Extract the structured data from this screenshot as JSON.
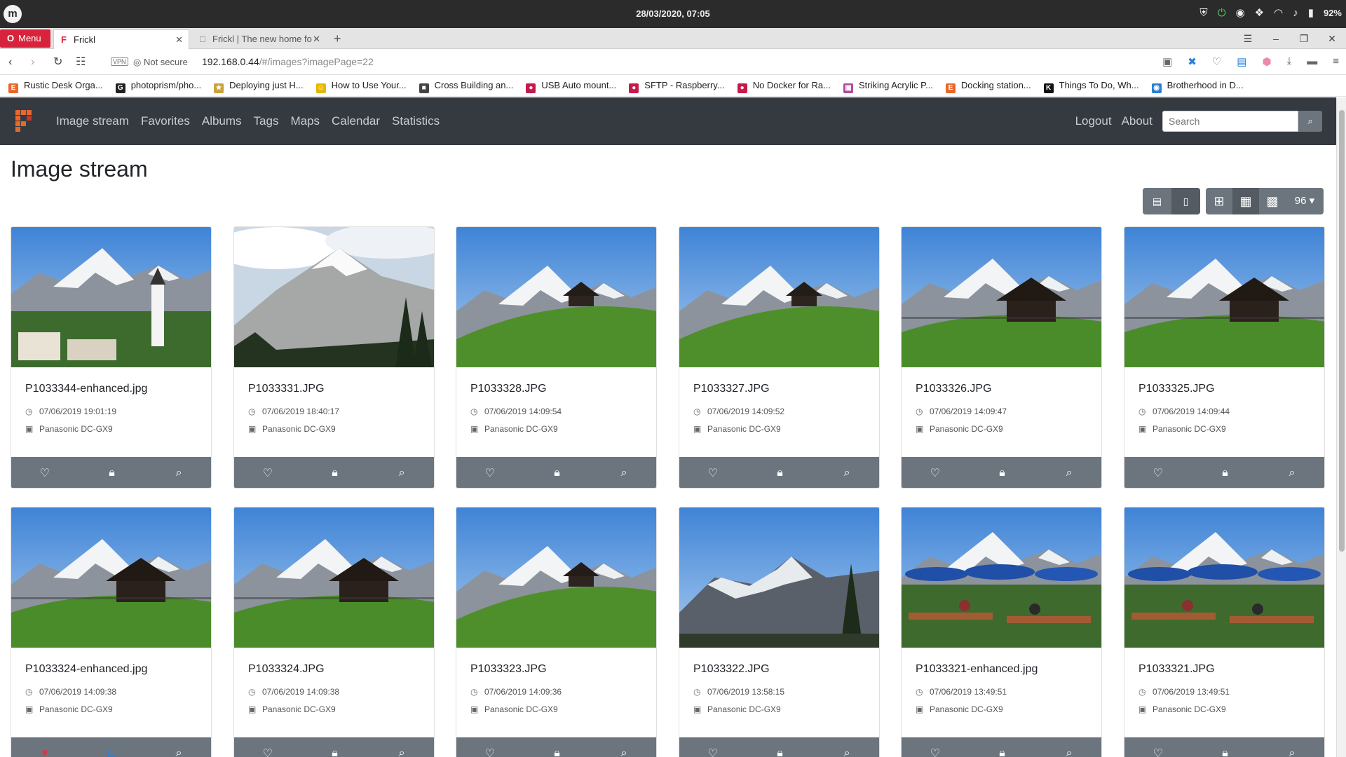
{
  "os": {
    "clock": "28/03/2020, 07:05",
    "battery": "92%"
  },
  "browser": {
    "menu_label": "Menu",
    "tabs": [
      {
        "title": "Frickl"
      },
      {
        "title": "Frickl | The new home fo"
      }
    ],
    "vpn": "VPN",
    "security": "Not secure",
    "url_host": "192.168.0.44",
    "url_rest": "/#/images?imagePage=22",
    "bookmarks": [
      {
        "label": "Rustic Desk Orga...",
        "color": "#e8672a",
        "letter": "E"
      },
      {
        "label": "photoprism/pho...",
        "color": "#222222",
        "letter": "G"
      },
      {
        "label": "Deploying just H...",
        "color": "#c9a23a",
        "letter": "★"
      },
      {
        "label": "How to Use Your...",
        "color": "#e6b800",
        "letter": "☺"
      },
      {
        "label": "Cross Building an...",
        "color": "#444444",
        "letter": "■"
      },
      {
        "label": "USB Auto mount...",
        "color": "#c51a4a",
        "letter": "●"
      },
      {
        "label": "SFTP - Raspberry...",
        "color": "#c51a4a",
        "letter": "●"
      },
      {
        "label": "No Docker for Ra...",
        "color": "#c51a4a",
        "letter": "●"
      },
      {
        "label": "Striking Acrylic P...",
        "color": "#b04a9e",
        "letter": "▣"
      },
      {
        "label": "Docking station...",
        "color": "#e8672a",
        "letter": "E"
      },
      {
        "label": "Things To Do, Wh...",
        "color": "#111111",
        "letter": "K"
      },
      {
        "label": "Brotherhood in D...",
        "color": "#2a7fd4",
        "letter": "◉"
      }
    ]
  },
  "app": {
    "nav": [
      "Image stream",
      "Favorites",
      "Albums",
      "Tags",
      "Maps",
      "Calendar",
      "Statistics"
    ],
    "logout": "Logout",
    "about": "About",
    "search_placeholder": "Search",
    "page_title": "Image stream",
    "per_page": "96",
    "images": [
      {
        "name": "P1033344-enhanced.jpg",
        "date": "07/06/2019 19:01:19",
        "camera": "Panasonic DC-GX9",
        "favorite": false,
        "private": false,
        "scene": "village"
      },
      {
        "name": "P1033331.JPG",
        "date": "07/06/2019 18:40:17",
        "camera": "Panasonic DC-GX9",
        "favorite": false,
        "private": false,
        "scene": "peak"
      },
      {
        "name": "P1033328.JPG",
        "date": "07/06/2019 14:09:54",
        "camera": "Panasonic DC-GX9",
        "favorite": false,
        "private": false,
        "scene": "hut-small"
      },
      {
        "name": "P1033327.JPG",
        "date": "07/06/2019 14:09:52",
        "camera": "Panasonic DC-GX9",
        "favorite": false,
        "private": false,
        "scene": "hut-small"
      },
      {
        "name": "P1033326.JPG",
        "date": "07/06/2019 14:09:47",
        "camera": "Panasonic DC-GX9",
        "favorite": false,
        "private": false,
        "scene": "hut-big"
      },
      {
        "name": "P1033325.JPG",
        "date": "07/06/2019 14:09:44",
        "camera": "Panasonic DC-GX9",
        "favorite": false,
        "private": false,
        "scene": "hut-big"
      },
      {
        "name": "P1033324-enhanced.jpg",
        "date": "07/06/2019 14:09:38",
        "camera": "Panasonic DC-GX9",
        "favorite": true,
        "private": true,
        "scene": "hut-big"
      },
      {
        "name": "P1033324.JPG",
        "date": "07/06/2019 14:09:38",
        "camera": "Panasonic DC-GX9",
        "favorite": false,
        "private": false,
        "scene": "hut-big"
      },
      {
        "name": "P1033323.JPG",
        "date": "07/06/2019 14:09:36",
        "camera": "Panasonic DC-GX9",
        "favorite": false,
        "private": false,
        "scene": "hut-small"
      },
      {
        "name": "P1033322.JPG",
        "date": "07/06/2019 13:58:15",
        "camera": "Panasonic DC-GX9",
        "favorite": false,
        "private": false,
        "scene": "tree"
      },
      {
        "name": "P1033321-enhanced.jpg",
        "date": "07/06/2019 13:49:51",
        "camera": "Panasonic DC-GX9",
        "favorite": false,
        "private": false,
        "scene": "terrace"
      },
      {
        "name": "P1033321.JPG",
        "date": "07/06/2019 13:49:51",
        "camera": "Panasonic DC-GX9",
        "favorite": false,
        "private": false,
        "scene": "terrace"
      }
    ]
  },
  "colors": {
    "navbar": "#343a40",
    "button_gray": "#6c757d",
    "menu_red": "#d7243c",
    "favorite_red": "#dc3545",
    "private_blue": "#2a7fd4"
  }
}
